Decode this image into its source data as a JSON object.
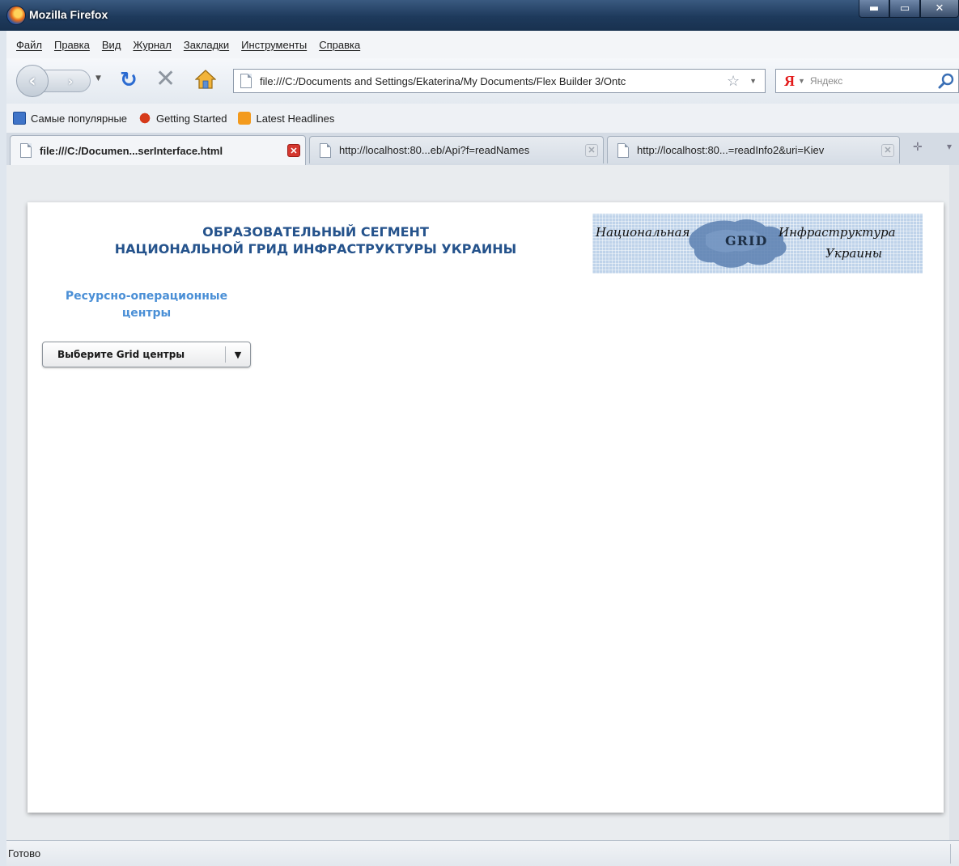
{
  "window": {
    "title": "Mozilla Firefox"
  },
  "menu": [
    "Файл",
    "Правка",
    "Вид",
    "Журнал",
    "Закладки",
    "Инструменты",
    "Справка"
  ],
  "nav": {
    "url": "file:///C:/Documents and Settings/Ekaterina/My Documents/Flex Builder 3/Ontc",
    "search_placeholder": "Яндекс",
    "search_engine": "Я"
  },
  "bookmarks": [
    "Самые популярные",
    "Getting Started",
    "Latest Headlines"
  ],
  "tabs": [
    {
      "title": "file:///C:/Documen...serInterface.html",
      "active": true
    },
    {
      "title": "http://localhost:80...eb/Api?f=readNames",
      "active": false
    },
    {
      "title": "http://localhost:80...=readInfo2&uri=Kiev",
      "active": false
    }
  ],
  "page": {
    "heading_line1": "ОБРАЗОВАТЕЛЬНЫЙ СЕГМЕНТ",
    "heading_line2": "НАЦИОНАЛЬНОЙ ГРИД ИНФРАСТРУКТУРЫ УКРАИНЫ",
    "banner": {
      "text1": "Национальная",
      "text2": "Инфраструктура",
      "text3": "Украины",
      "logo": "GRID"
    },
    "resource_label_line1": "Ресурсно-операционные",
    "resource_label_line2": "центры",
    "grid_select_value": "Выберите Grid центры"
  },
  "status": {
    "text": "Готово"
  },
  "colors": {
    "heading": "#25538c",
    "resource_label": "#4a8fd6",
    "title_bar": "#1e3a5c"
  }
}
